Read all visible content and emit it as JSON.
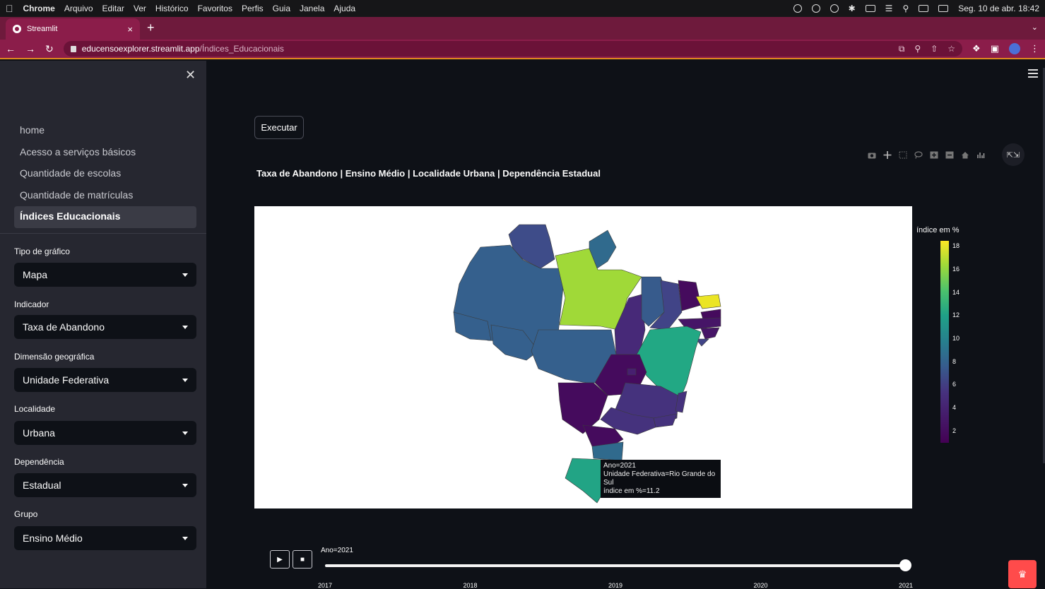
{
  "menubar": {
    "app_name": "Chrome",
    "items": [
      "Arquivo",
      "Editar",
      "Ver",
      "Histórico",
      "Favoritos",
      "Perfis",
      "Guia",
      "Janela",
      "Ajuda"
    ],
    "clock": "Seg. 10 de abr. 18:42"
  },
  "browser": {
    "tab_title": "Streamlit",
    "url_host": "educensoexplorer.streamlit.app",
    "url_path": "/Índices_Educacionais"
  },
  "sidebar": {
    "nav": [
      {
        "label": "home",
        "active": false
      },
      {
        "label": "Acesso a serviços básicos",
        "active": false
      },
      {
        "label": "Quantidade de escolas",
        "active": false
      },
      {
        "label": "Quantidade de matrículas",
        "active": false
      },
      {
        "label": "Índices Educacionais",
        "active": true
      }
    ],
    "fields": [
      {
        "label": "Tipo de gráfico",
        "value": "Mapa"
      },
      {
        "label": "Indicador",
        "value": "Taxa de Abandono"
      },
      {
        "label": "Dimensão geográfica",
        "value": "Unidade Federativa"
      },
      {
        "label": "Localidade",
        "value": "Urbana"
      },
      {
        "label": "Dependência",
        "value": "Estadual"
      },
      {
        "label": "Grupo",
        "value": "Ensino Médio"
      }
    ]
  },
  "main": {
    "run_button": "Executar",
    "chart_title": "Taxa de Abandono | Ensino Médio | Localidade Urbana | Dependência Estadual"
  },
  "chart_data": {
    "type": "choropleth",
    "title": "Taxa de Abandono | Ensino Médio | Localidade Urbana | Dependência Estadual",
    "colorbar_title": "índice em %",
    "colorscale": "viridis",
    "colorbar_ticks": [
      2,
      4,
      6,
      8,
      10,
      12,
      14,
      16,
      18
    ],
    "color_range": [
      1,
      18.5
    ],
    "animation_frame_label": "Ano=2021",
    "frames": [
      "2017",
      "2018",
      "2019",
      "2020",
      "2021"
    ],
    "current_frame": "2021",
    "regions": [
      {
        "name": "Roraima",
        "value": 5.0
      },
      {
        "name": "Amapá",
        "value": 7.0
      },
      {
        "name": "Amazonas",
        "value": 6.3
      },
      {
        "name": "Pará",
        "value": 16.0
      },
      {
        "name": "Acre",
        "value": 6.3
      },
      {
        "name": "Rondônia",
        "value": 6.3
      },
      {
        "name": "Mato Grosso",
        "value": 6.3
      },
      {
        "name": "Tocantins",
        "value": 3.0
      },
      {
        "name": "Maranhão",
        "value": 6.0
      },
      {
        "name": "Piauí",
        "value": 4.5
      },
      {
        "name": "Ceará",
        "value": 1.5
      },
      {
        "name": "Rio Grande do Norte",
        "value": 18.0
      },
      {
        "name": "Paraíba",
        "value": 1.5
      },
      {
        "name": "Pernambuco",
        "value": 2.0
      },
      {
        "name": "Alagoas",
        "value": 2.0
      },
      {
        "name": "Sergipe",
        "value": 4.5
      },
      {
        "name": "Bahia",
        "value": 11.5
      },
      {
        "name": "Goiás",
        "value": 1.5
      },
      {
        "name": "Distrito Federal",
        "value": 2.5
      },
      {
        "name": "Minas Gerais",
        "value": 3.5
      },
      {
        "name": "Espírito Santo",
        "value": 3.5
      },
      {
        "name": "Rio de Janeiro",
        "value": 3.5
      },
      {
        "name": "São Paulo",
        "value": 3.5
      },
      {
        "name": "Mato Grosso do Sul",
        "value": 1.5
      },
      {
        "name": "Paraná",
        "value": 1.5
      },
      {
        "name": "Santa Catarina",
        "value": 7.0
      },
      {
        "name": "Rio Grande do Sul",
        "value": 11.2
      }
    ],
    "tooltip": {
      "ano": "Ano=2021",
      "uf": "Unidade Federativa=Rio Grande do Sul",
      "indice": "índice em %=11.2"
    }
  },
  "colors": {
    "sidebar_bg": "#262730",
    "main_bg": "#0e1117",
    "tab_bg": "#8b1d4a",
    "deploy": "#ff4b4b"
  }
}
